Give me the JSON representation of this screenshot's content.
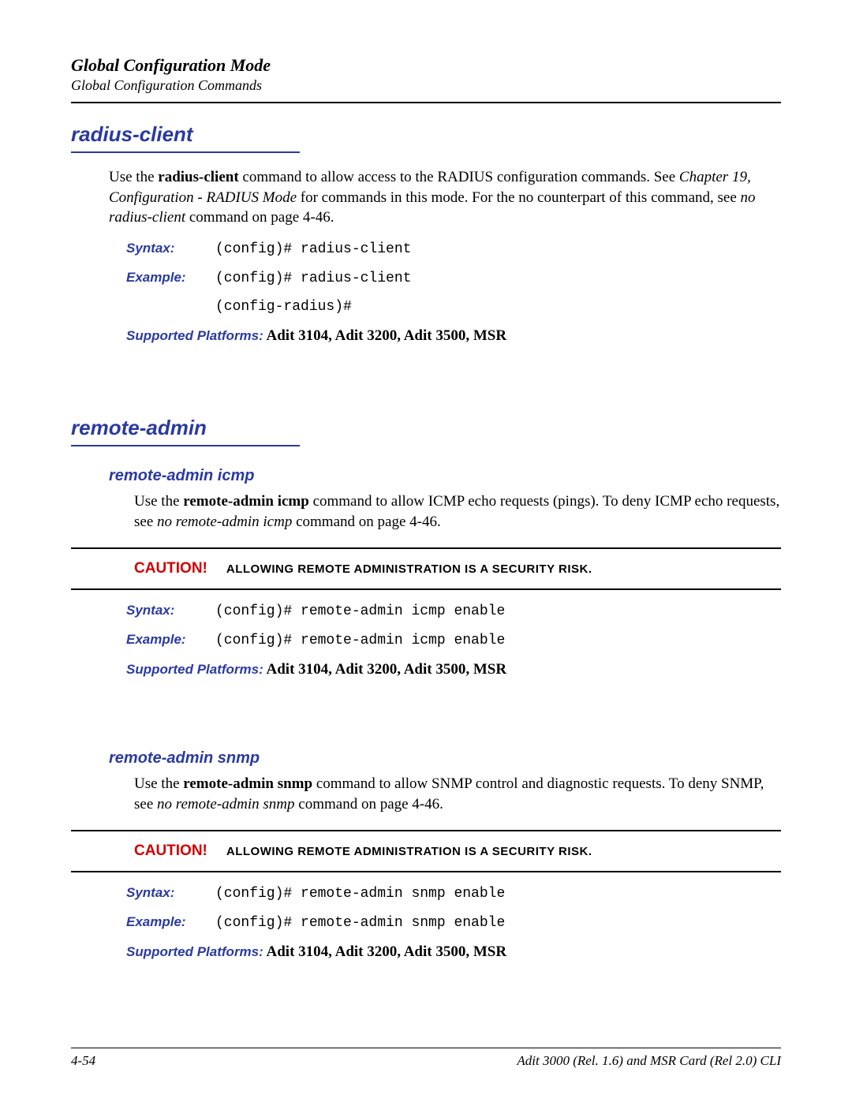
{
  "header": {
    "title": "Global Configuration Mode",
    "subtitle": "Global Configuration Commands"
  },
  "section1": {
    "heading": "radius-client",
    "para_pre": "Use the ",
    "para_bold1": "radius-client",
    "para_mid1": " command to allow access to the RADIUS configuration commands. See ",
    "para_ital1": "Chapter 19, Configuration - RADIUS Mode",
    "para_mid2": " for commands in this mode. For the no counterpart of this command, see  ",
    "para_ital2": "no radius-client",
    "para_end": " command on page 4-46.",
    "syntax_label": "Syntax:",
    "syntax_value": "(config)# radius-client",
    "example_label": "Example:",
    "example_value1": "(config)# radius-client",
    "example_value2": "(config-radius)#",
    "platforms_label": "Supported Platforms:",
    "platforms_value": " Adit 3104, Adit 3200, Adit 3500, MSR"
  },
  "section2": {
    "heading": "remote-admin",
    "sub1": {
      "heading": "remote-admin icmp",
      "para_pre": "Use the ",
      "para_bold": "remote-admin icmp",
      "para_mid1": " command to allow ICMP echo requests (pings). To deny ICMP echo requests, see  ",
      "para_ital": "no remote-admin icmp",
      "para_end": " command on page 4-46.",
      "caution_label": "CAUTION!",
      "caution_text": "ALLOWING REMOTE ADMINISTRATION IS A SECURITY RISK.",
      "syntax_label": "Syntax:",
      "syntax_value": "(config)# remote-admin icmp enable",
      "example_label": "Example:",
      "example_value": "(config)# remote-admin icmp enable",
      "platforms_label": "Supported Platforms:",
      "platforms_value": " Adit 3104, Adit 3200, Adit 3500, MSR"
    },
    "sub2": {
      "heading": "remote-admin snmp",
      "para_pre": "Use the ",
      "para_bold": "remote-admin snmp",
      "para_mid1": " command to allow SNMP control and diagnostic requests. To deny SNMP, see  ",
      "para_ital": "no remote-admin snmp",
      "para_end": " command on page 4-46.",
      "caution_label": "CAUTION!",
      "caution_text": "ALLOWING REMOTE ADMINISTRATION IS A SECURITY RISK.",
      "syntax_label": "Syntax:",
      "syntax_value": "(config)# remote-admin snmp enable",
      "example_label": "Example:",
      "example_value": "(config)# remote-admin snmp enable",
      "platforms_label": "Supported Platforms:",
      "platforms_value": " Adit 3104, Adit 3200, Adit 3500, MSR"
    }
  },
  "footer": {
    "left": "4-54",
    "right": "Adit 3000 (Rel. 1.6) and MSR Card (Rel 2.0) CLI"
  }
}
